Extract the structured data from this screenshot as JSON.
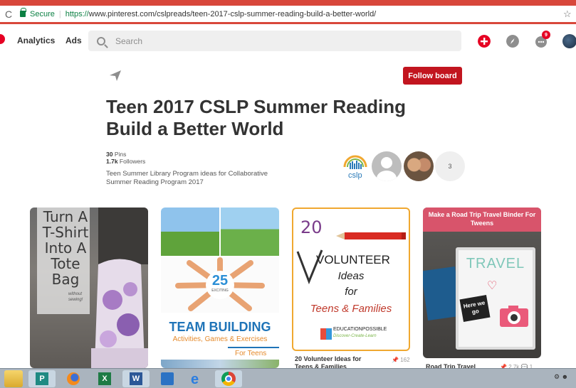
{
  "browser": {
    "reload": "C",
    "secure_label": "Secure",
    "url_scheme": "https://",
    "url_rest": "www.pinterest.com/cslpreads/teen-2017-cslp-summer-reading-build-a-better-world/",
    "bookmark": "☆"
  },
  "header": {
    "analytics": "Analytics",
    "ads": "Ads",
    "search_placeholder": "Search",
    "notification_count": "9"
  },
  "board": {
    "follow_label": "Follow board",
    "title": "Teen 2017 CSLP Summer Reading Build a Better World",
    "pins_count": "30",
    "pins_label": " Pins",
    "followers_count": "1.7k",
    "followers_label": " Followers",
    "description": "Teen Summer Library Program ideas for Collaborative Summer Reading Program 2017",
    "collaborator_logo_text": "cslp",
    "collaborators_more": "3"
  },
  "pins": [
    {
      "lines": [
        "Turn A",
        "T-Shirt",
        "Into A",
        "Tote",
        "Bag"
      ],
      "small": [
        "without",
        "sewing!"
      ]
    },
    {
      "number": "25",
      "exciting": "EXCITING",
      "heading": "TEAM BUILDING",
      "sub": "Activities, Games & Exercises",
      "for": "For Teens"
    },
    {
      "num": "20",
      "big": "VOLUNTEER",
      "ideas": "Ideas",
      "for": "for",
      "teens": "Teens & Families",
      "brand": "EDUCATIONPOSSIBLE",
      "brand_sub": "Discover-Create-Learn",
      "caption": "20 Volunteer Ideas for Teens & Families",
      "saves": "162"
    },
    {
      "banner": "Make a Road Trip Travel Binder For Tweens",
      "binder_title": "TRAVEL",
      "sticker": "Here we go",
      "caption": "Road Trip Travel",
      "saves": "2.7k",
      "comments": "1"
    }
  ],
  "colors": {
    "brand_red": "#e60023",
    "follow_red": "#c2151f",
    "chrome_red": "#d8473b",
    "team_blue": "#1f74b8",
    "volunteer_red": "#c0392b"
  }
}
